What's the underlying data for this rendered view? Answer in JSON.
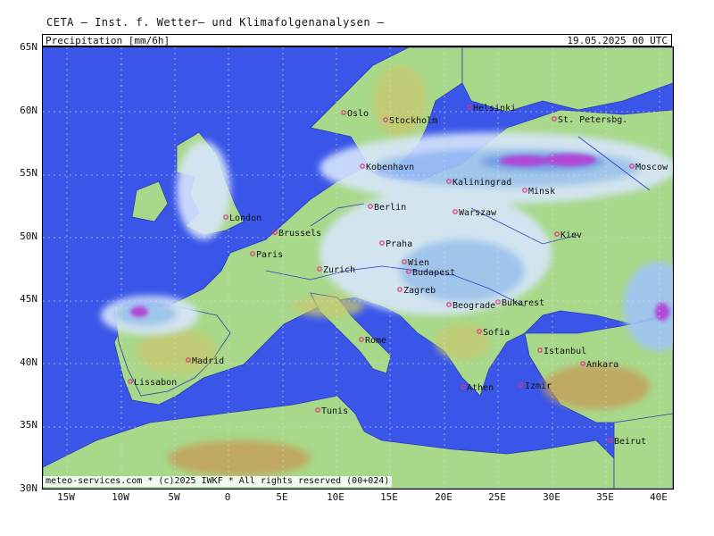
{
  "title": "CETA — Inst. f. Wetter— und Klimafolgenanalysen —",
  "header": {
    "variable": "Precipitation",
    "unit": "[mm/6h]",
    "datetime": "19.05.2025 00 UTC"
  },
  "footer": "meteo-services.com * (c)2025 IWKF * All rights reserved (00+024)",
  "axes": {
    "lat_labels": [
      "65N",
      "60N",
      "55N",
      "50N",
      "45N",
      "40N",
      "35N",
      "30N"
    ],
    "lon_labels": [
      "15W",
      "10W",
      "5W",
      "0",
      "5E",
      "10E",
      "15E",
      "20E",
      "25E",
      "30E",
      "35E",
      "40E"
    ]
  },
  "colors": {
    "sea": "#3a56e8",
    "land_low": "#a8d88a",
    "land_mid": "#c9c76e",
    "land_high": "#c89a56",
    "precip_light": "#d7e6fb",
    "precip_mid": "#9fc4f5",
    "precip_high": "#6c95ee",
    "precip_peak": "#b14ad6",
    "rivers": "#2d3dc8",
    "borders": "#555555",
    "city_marker": "#e0307a"
  },
  "cities": [
    {
      "name": "Oslo"
    },
    {
      "name": "Stockholm"
    },
    {
      "name": "Helsinki"
    },
    {
      "name": "St. Petersbg."
    },
    {
      "name": "Kobenhavn"
    },
    {
      "name": "Kaliningrad"
    },
    {
      "name": "Minsk"
    },
    {
      "name": "Moscow"
    },
    {
      "name": "London"
    },
    {
      "name": "Berlin"
    },
    {
      "name": "Warszaw"
    },
    {
      "name": "Brussels"
    },
    {
      "name": "Praha"
    },
    {
      "name": "Kiev"
    },
    {
      "name": "Paris"
    },
    {
      "name": "Wien"
    },
    {
      "name": "Zurich"
    },
    {
      "name": "Budapest"
    },
    {
      "name": "Zagreb"
    },
    {
      "name": "Beograde"
    },
    {
      "name": "Bukarest"
    },
    {
      "name": "Madrid"
    },
    {
      "name": "Rome"
    },
    {
      "name": "Sofia"
    },
    {
      "name": "Istanbul"
    },
    {
      "name": "Lissabon"
    },
    {
      "name": "Ankara"
    },
    {
      "name": "Athen"
    },
    {
      "name": "Izmir"
    },
    {
      "name": "Tunis"
    },
    {
      "name": "Beirut"
    }
  ]
}
